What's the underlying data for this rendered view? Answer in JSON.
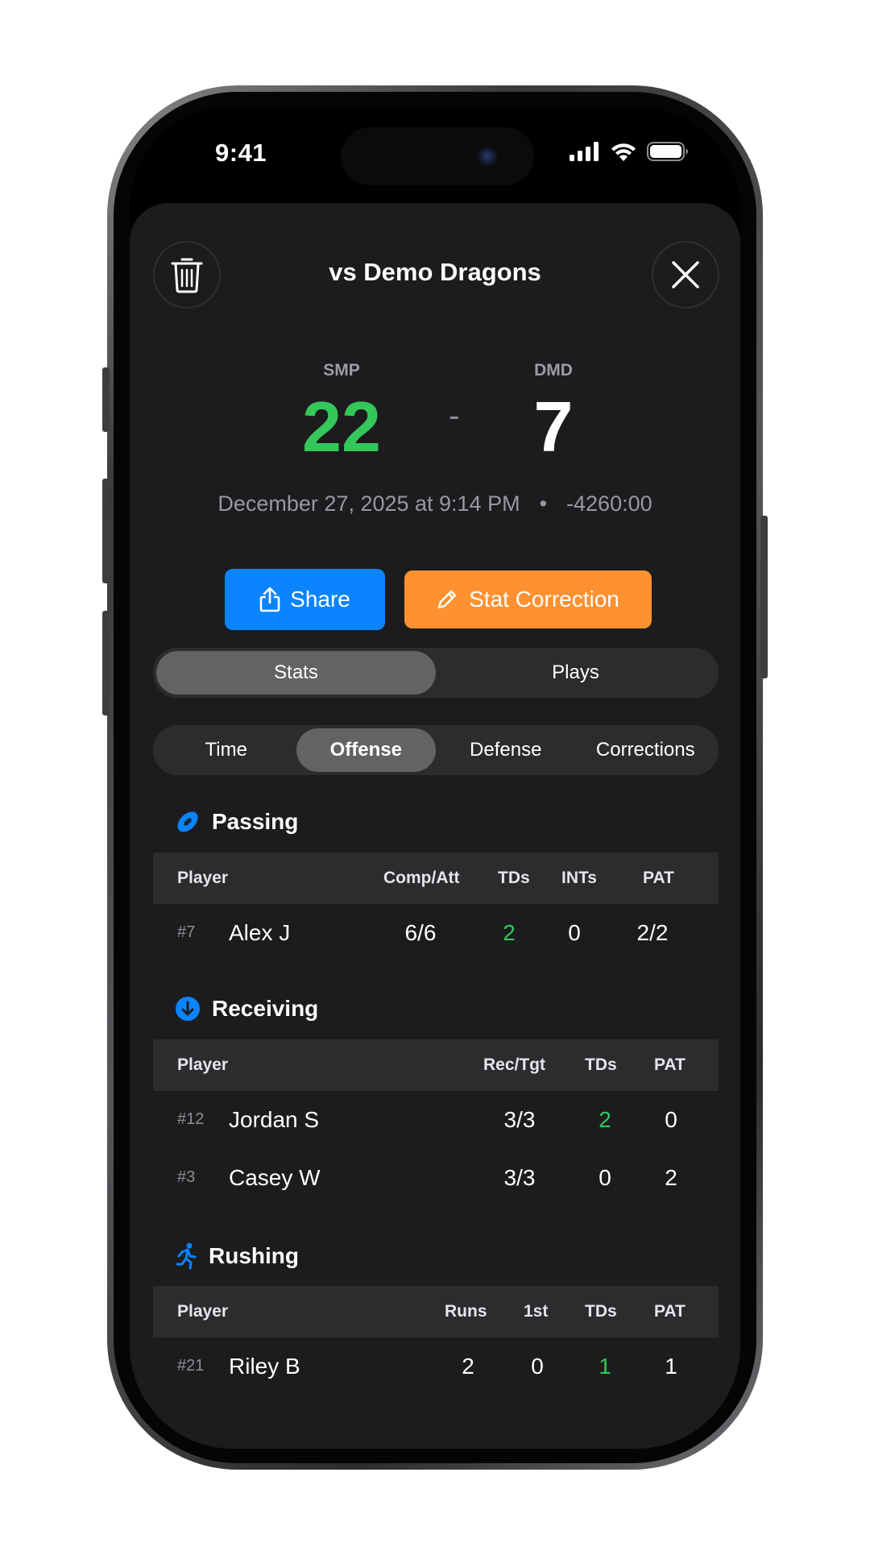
{
  "status_bar": {
    "time": "9:41"
  },
  "header": {
    "title": "vs Demo Dragons"
  },
  "scoreboard": {
    "home_abbr": "SMP",
    "home_score": "22",
    "separator": "-",
    "away_abbr": "DMD",
    "away_score": "7",
    "date": "December 27, 2025 at 9:14 PM",
    "dot": "•",
    "duration": "-4260:00"
  },
  "actions": {
    "share_label": "Share",
    "correction_label": "Stat Correction"
  },
  "main_tabs": [
    {
      "label": "Stats",
      "active": true
    },
    {
      "label": "Plays",
      "active": false
    }
  ],
  "sub_tabs": [
    {
      "label": "Time",
      "active": false
    },
    {
      "label": "Offense",
      "active": true
    },
    {
      "label": "Defense",
      "active": false
    },
    {
      "label": "Corrections",
      "active": false
    }
  ],
  "passing": {
    "title": "Passing",
    "headers": [
      "Player",
      "Comp/Att",
      "TDs",
      "INTs",
      "PAT"
    ],
    "rows": [
      {
        "number": "#7",
        "name": "Alex J",
        "comp_att": "6/6",
        "tds": "2",
        "ints": "0",
        "pat": "2/2"
      }
    ]
  },
  "receiving": {
    "title": "Receiving",
    "headers": [
      "Player",
      "Rec/Tgt",
      "TDs",
      "PAT"
    ],
    "rows": [
      {
        "number": "#12",
        "name": "Jordan S",
        "rec_tgt": "3/3",
        "tds": "2",
        "pat": "0"
      },
      {
        "number": "#3",
        "name": "Casey W",
        "rec_tgt": "3/3",
        "tds": "0",
        "pat": "2"
      }
    ]
  },
  "rushing": {
    "title": "Rushing",
    "headers": [
      "Player",
      "Runs",
      "1st",
      "TDs",
      "PAT"
    ],
    "rows": [
      {
        "number": "#21",
        "name": "Riley B",
        "runs": "2",
        "first": "0",
        "tds": "1",
        "pat": "1"
      }
    ]
  },
  "colors": {
    "accent_blue": "#0a84ff",
    "accent_orange": "#ff9130",
    "positive_green": "#34c759",
    "sheet_bg": "#1c1c1e"
  },
  "icons": [
    "trash-icon",
    "close-icon",
    "share-icon",
    "pencil-icon",
    "football-icon",
    "receive-arrow-icon",
    "runner-icon",
    "signal-icon",
    "wifi-icon",
    "battery-icon"
  ]
}
